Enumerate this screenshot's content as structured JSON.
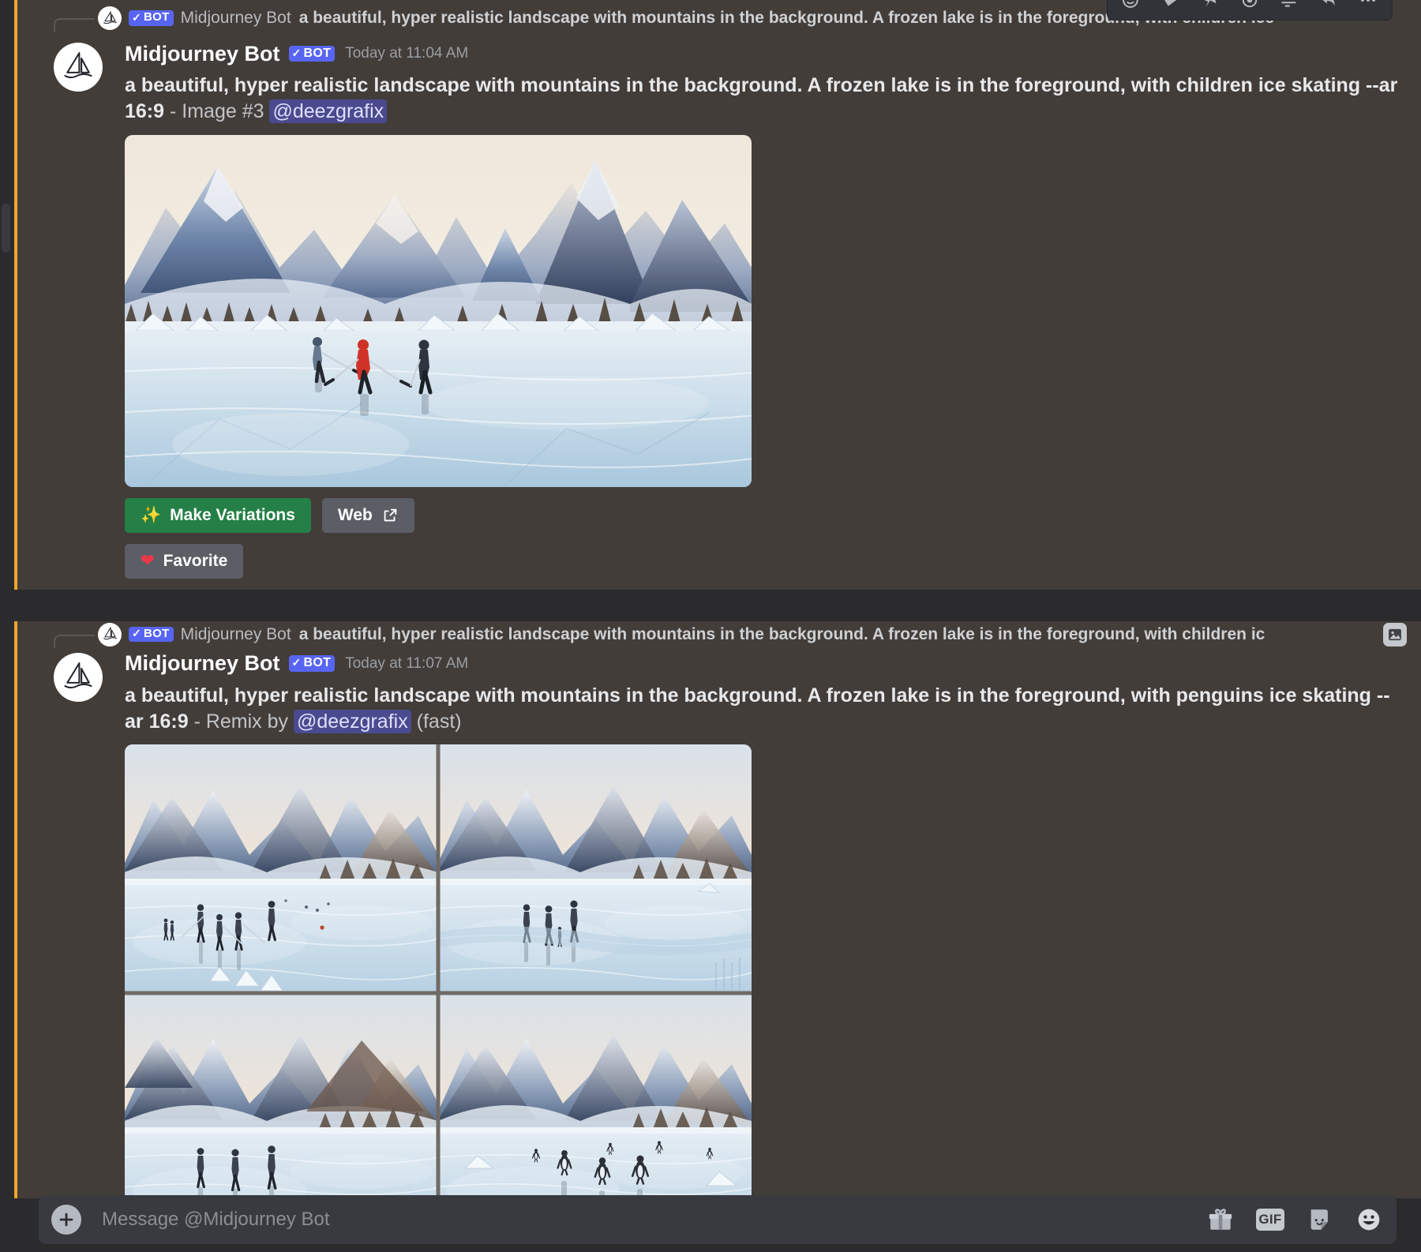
{
  "colors": {
    "mention_highlight_bg": "#423d39",
    "mention_bar": "#f0a52a",
    "app_bg": "#2b2b2e",
    "bot_badge": "#5865f2",
    "button_green": "#248046",
    "button_grey": "#5c5e66",
    "mention_chip": "#4a4a8f"
  },
  "messages": [
    {
      "reply": {
        "author": "Midjourney Bot",
        "bot_badge": "BOT",
        "text": "a beautiful, hyper realistic landscape with mountains in the background. A frozen lake is in the foreground, with children ice",
        "avatar_icon": "midjourney-sailboat-icon",
        "attachment_icon": null
      },
      "author": "Midjourney Bot",
      "bot_badge": "BOT",
      "timestamp": "Today at 11:04 AM",
      "prompt_main": "a beautiful, hyper realistic landscape with mountains in the background. A frozen lake is in the foreground, with children ice skating -",
      "prompt_flag": "-ar 16:9",
      "prompt_suffix": " - Image #3 ",
      "mention": "@deezgrafix",
      "prompt_tail": "",
      "image": {
        "type": "single",
        "alt": "frozen lake with three children ice skating, snowy mountains"
      },
      "buttons": [
        {
          "label": "Make Variations",
          "style": "green",
          "icon": "magic-wand-icon"
        },
        {
          "label": "Web",
          "style": "grey",
          "icon": "external-link-icon"
        },
        {
          "label": "Favorite",
          "style": "grey",
          "icon": "heart-icon"
        }
      ]
    },
    {
      "reply": {
        "author": "Midjourney Bot",
        "bot_badge": "BOT",
        "text": "a beautiful, hyper realistic landscape with mountains in the background. A frozen lake is in the foreground, with children ic",
        "avatar_icon": "midjourney-sailboat-icon",
        "attachment_icon": "image-attachment-icon"
      },
      "author": "Midjourney Bot",
      "bot_badge": "BOT",
      "timestamp": "Today at 11:07 AM",
      "prompt_main": "a beautiful, hyper realistic landscape with mountains in the background. A frozen lake is in the foreground, with penguins ice skating ",
      "prompt_flag": "--ar 16:9",
      "prompt_suffix": " - Remix by ",
      "mention": "@deezgrafix",
      "prompt_tail": " (fast)",
      "image": {
        "type": "grid-2x2",
        "alt": "four variations of a frozen lake with penguins and people ice skating"
      },
      "buttons": []
    }
  ],
  "hover_toolbar": {
    "items": [
      {
        "name": "add-reaction-icon",
        "label": "Add Reaction"
      },
      {
        "name": "super-reaction-icon",
        "label": "Super Reaction"
      },
      {
        "name": "pin-icon",
        "label": "Pin Message"
      },
      {
        "name": "mark-unread-icon",
        "label": "Mark Unread"
      },
      {
        "name": "thread-icon",
        "label": "Create Thread"
      },
      {
        "name": "reply-icon",
        "label": "Reply"
      },
      {
        "name": "more-icon",
        "label": "More"
      }
    ]
  },
  "composer": {
    "placeholder": "Message @Midjourney Bot",
    "value": "",
    "plus_icon": "plus-icon",
    "icons": [
      {
        "name": "gift-icon",
        "label": "Gift"
      },
      {
        "name": "gif-icon",
        "label": "GIF"
      },
      {
        "name": "sticker-icon",
        "label": "Sticker"
      },
      {
        "name": "emoji-icon",
        "label": "Emoji"
      }
    ]
  }
}
